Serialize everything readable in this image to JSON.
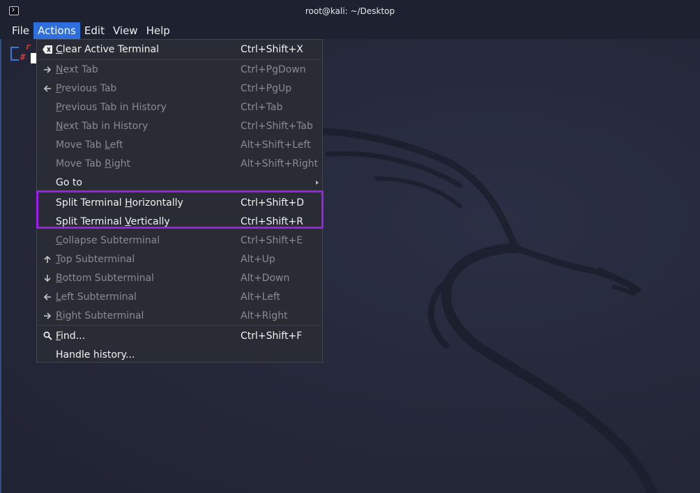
{
  "window": {
    "title": "root@kali: ~/Desktop"
  },
  "menubar": [
    {
      "label": "File",
      "active": false
    },
    {
      "label": "Actions",
      "active": true
    },
    {
      "label": "Edit",
      "active": false
    },
    {
      "label": "View",
      "active": false
    },
    {
      "label": "Help",
      "active": false
    }
  ],
  "terminal": {
    "prompt_r": "r",
    "prompt_hash": "#"
  },
  "actions_menu": {
    "items": [
      {
        "label": "Clear Active Terminal",
        "mnemonic_index": 0,
        "shortcut": "Ctrl+Shift+X",
        "icon": "clear-terminal-icon",
        "enabled": true
      },
      {
        "label": "Next Tab",
        "mnemonic_index": 0,
        "shortcut": "Ctrl+PgDown",
        "icon": "arrow-right-icon",
        "enabled": false
      },
      {
        "label": "Previous Tab",
        "mnemonic_index": 0,
        "shortcut": "Ctrl+PgUp",
        "icon": "arrow-left-icon",
        "enabled": false
      },
      {
        "label": "Previous Tab in History",
        "mnemonic_index": 0,
        "shortcut": "Ctrl+Tab",
        "icon": "",
        "enabled": false
      },
      {
        "label": "Next Tab in History",
        "mnemonic_index": 0,
        "shortcut": "Ctrl+Shift+Tab",
        "icon": "",
        "enabled": false
      },
      {
        "label": "Move Tab Left",
        "mnemonic_index": 9,
        "shortcut": "Alt+Shift+Left",
        "icon": "",
        "enabled": false
      },
      {
        "label": "Move Tab Right",
        "mnemonic_index": 9,
        "shortcut": "Alt+Shift+Right",
        "icon": "",
        "enabled": false
      },
      {
        "label": "Go to",
        "mnemonic_index": -1,
        "shortcut": "",
        "icon": "",
        "enabled": true,
        "submenu": true
      },
      {
        "label": "Split Terminal Horizontally",
        "mnemonic_index": 15,
        "shortcut": "Ctrl+Shift+D",
        "icon": "",
        "enabled": true
      },
      {
        "label": "Split Terminal Vertically",
        "mnemonic_index": 15,
        "shortcut": "Ctrl+Shift+R",
        "icon": "",
        "enabled": true
      },
      {
        "label": "Collapse Subterminal",
        "mnemonic_index": 0,
        "shortcut": "Ctrl+Shift+E",
        "icon": "",
        "enabled": false
      },
      {
        "label": "Top Subterminal",
        "mnemonic_index": 0,
        "shortcut": "Alt+Up",
        "icon": "arrow-up-icon",
        "enabled": false
      },
      {
        "label": "Bottom Subterminal",
        "mnemonic_index": 0,
        "shortcut": "Alt+Down",
        "icon": "arrow-down-icon",
        "enabled": false
      },
      {
        "label": "Left Subterminal",
        "mnemonic_index": 0,
        "shortcut": "Alt+Left",
        "icon": "arrow-left-icon",
        "enabled": false
      },
      {
        "label": "Right Subterminal",
        "mnemonic_index": 0,
        "shortcut": "Alt+Right",
        "icon": "arrow-right-icon",
        "enabled": false
      },
      {
        "label": "Find...",
        "mnemonic_index": 0,
        "shortcut": "Ctrl+Shift+F",
        "icon": "search-icon",
        "enabled": true
      },
      {
        "label": "Handle history...",
        "mnemonic_index": -1,
        "shortcut": "",
        "icon": "",
        "enabled": true
      }
    ]
  },
  "colors": {
    "menu_active": "#2f6fdd",
    "highlight_outline": "#9b1fe8",
    "prompt_red": "#e83131",
    "prompt_blue": "#3a77d8"
  }
}
